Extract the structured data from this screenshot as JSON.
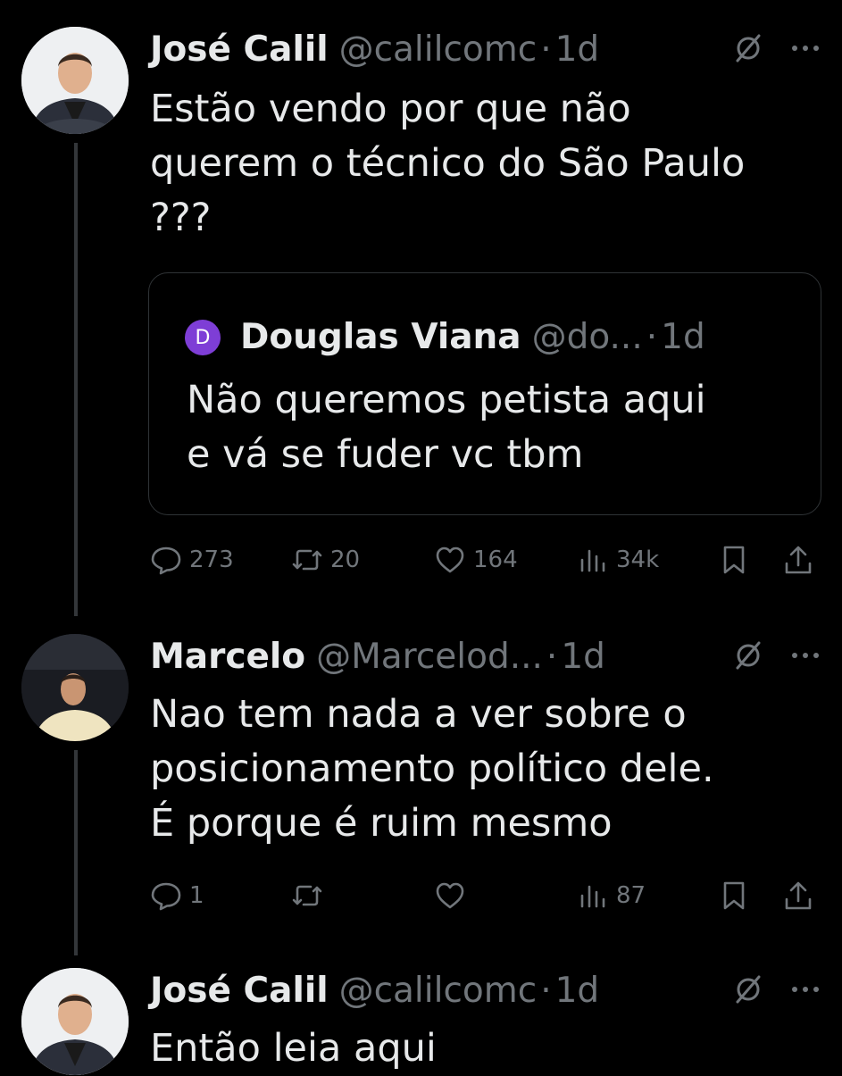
{
  "tweets": [
    {
      "name": "José Calil",
      "handle": "@calilcomc",
      "separator": "·",
      "time": "1d",
      "text": "Estão vendo por que não\nquerem o técnico do São Paulo\n???",
      "quote": {
        "avatar_letter": "D",
        "avatar_color": "#7e3ed6",
        "name": "Douglas Viana",
        "handle": "@do...",
        "separator": "·",
        "time": "1d",
        "text": "Não queremos petista aqui\ne vá se fuder vc tbm"
      },
      "actions": {
        "replies": "273",
        "retweets": "20",
        "likes": "164",
        "views": "34k"
      }
    },
    {
      "name": "Marcelo",
      "handle": "@Marcelod...",
      "separator": "·",
      "time": "1d",
      "text": "Nao tem nada a ver sobre o\nposicionamento político dele.\nÉ porque é ruim mesmo",
      "actions": {
        "replies": "1",
        "retweets": "",
        "likes": "",
        "views": "87"
      }
    },
    {
      "name": "José Calil",
      "handle": "@calilcomc",
      "separator": "·",
      "time": "1d",
      "text": "Então leia aqui"
    }
  ],
  "icons": [
    "grok-icon",
    "more-icon",
    "reply-icon",
    "retweet-icon",
    "like-icon",
    "views-icon",
    "bookmark-icon",
    "share-icon"
  ],
  "colors": {
    "background": "#000000",
    "text": "#e7e9ea",
    "secondary": "#71767b",
    "border": "#2f3336"
  }
}
